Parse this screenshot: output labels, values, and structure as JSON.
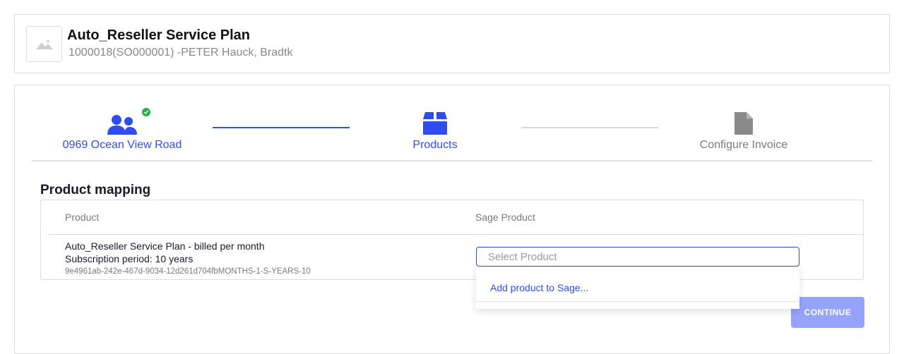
{
  "header": {
    "title": "Auto_Reseller Service Plan",
    "subtitle": "1000018(SO000001) -PETER Hauck, Bradtk",
    "thumbnail_icon": "image-placeholder-icon"
  },
  "stepper": {
    "steps": [
      {
        "label": "0969 Ocean View Road",
        "icon": "users-icon",
        "state": "completed"
      },
      {
        "label": "Products",
        "icon": "box-icon",
        "state": "active"
      },
      {
        "label": "Configure Invoice",
        "icon": "document-icon",
        "state": "pending"
      }
    ]
  },
  "mapping": {
    "title": "Product mapping",
    "columns": [
      "Product",
      "Sage Product"
    ],
    "rows": [
      {
        "name": "Auto_Reseller Service Plan - billed per month",
        "period": "Subscription period: 10 years",
        "id": "9e4961ab-242e-467d-9034-12d261d704fbMONTHS-1-S-YEARS-10"
      }
    ],
    "select": {
      "placeholder": "Select Product",
      "options": [
        "Add product to Sage..."
      ]
    }
  },
  "actions": {
    "continue_label": "CONTINUE"
  },
  "colors": {
    "accent": "#2f4cf0",
    "success": "#22b14c",
    "button_disabled": "#95a3fb",
    "muted_text": "#7a7a7a"
  }
}
